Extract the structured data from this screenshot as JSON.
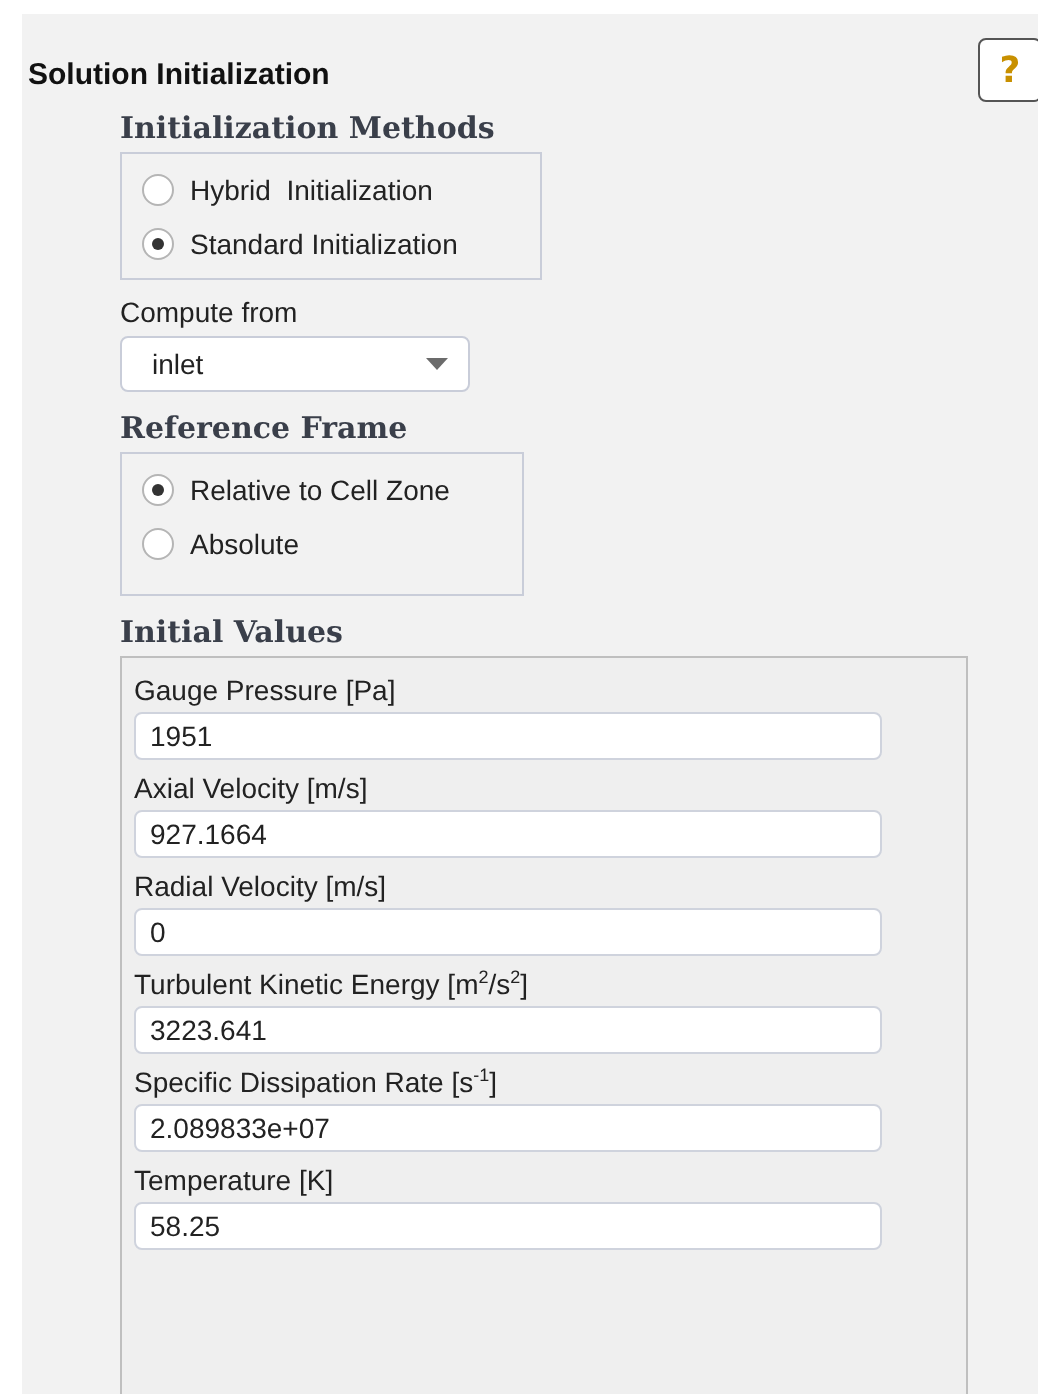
{
  "title": "Solution Initialization",
  "help_button": {
    "label": "?"
  },
  "initialization_methods": {
    "heading": "Initialization Methods",
    "options": [
      {
        "label": "Hybrid  Initialization",
        "selected": false
      },
      {
        "label": "Standard Initialization",
        "selected": true
      }
    ]
  },
  "compute_from": {
    "label": "Compute from",
    "value": "inlet"
  },
  "reference_frame": {
    "heading": "Reference Frame",
    "options": [
      {
        "label": "Relative to Cell Zone",
        "selected": true
      },
      {
        "label": "Absolute",
        "selected": false
      }
    ]
  },
  "initial_values": {
    "heading": "Initial Values",
    "fields": [
      {
        "label": "Gauge Pressure [Pa]",
        "value": "1951"
      },
      {
        "label": "Axial Velocity [m/s]",
        "value": "927.1664"
      },
      {
        "label": "Radial Velocity [m/s]",
        "value": "0"
      },
      {
        "label": "Turbulent Kinetic Energy [m$^{2}$/s$^{2}$]",
        "value": "3223.641"
      },
      {
        "label": "Specific Dissipation Rate [s$^{-1}$]",
        "value": "2.089833e+07"
      },
      {
        "label": "Temperature [K]",
        "value": "58.25"
      }
    ]
  }
}
